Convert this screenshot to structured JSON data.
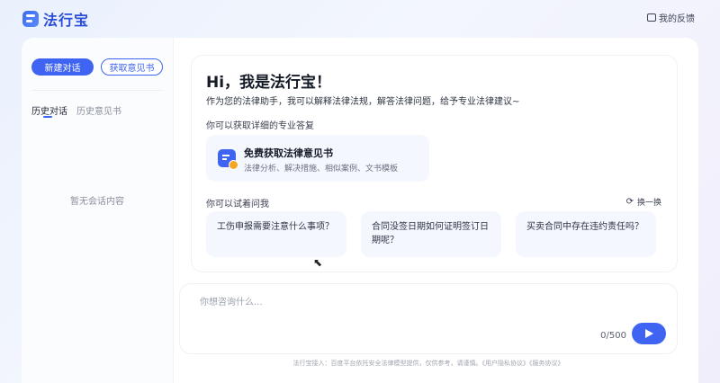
{
  "app": {
    "name": "法行宝"
  },
  "header": {
    "feedback_label": "我的反馈"
  },
  "sidebar": {
    "new_chat_label": "新建对话",
    "get_opinion_label": "获取意见书",
    "tabs": [
      {
        "label": "历史对话",
        "active": true
      },
      {
        "label": "历史意见书",
        "active": false
      }
    ],
    "empty_text": "暂无会话内容"
  },
  "welcome": {
    "greeting": "Hi，我是法行宝！",
    "intro": "作为您的法律助手，我可以解释法律法规，解答法律问题，给予专业法律建议~",
    "services_title": "你可以获取详细的专业答复",
    "service_card": {
      "title": "免费获取法律意见书",
      "desc": "法律分析、解决措施、相似案例、文书模板"
    },
    "questions_title": "你可以试着问我",
    "refresh_label": "换一换",
    "questions": [
      "工伤申报需要注意什么事项？",
      "合同没签日期如何证明签订日期呢？",
      "买卖合同中存在违约责任吗？"
    ]
  },
  "input": {
    "placeholder": "你想咨询什么...",
    "value": "",
    "counter": "0/500"
  },
  "footer": {
    "text": "法行宝接入：百度平台依托安全法律模型提供，仅供参考，请谨慎。《用户隐私协议》《服务协议》"
  },
  "colors": {
    "accent": "#3f64f2",
    "card_bg": "#f4f7fe",
    "badge": "#f5a623"
  },
  "icons": {
    "logo": "logo-icon",
    "feedback": "feedback-icon",
    "service": "document-icon",
    "refresh": "refresh-icon",
    "send": "send-icon",
    "cursor": "mouse-pointer-icon"
  }
}
